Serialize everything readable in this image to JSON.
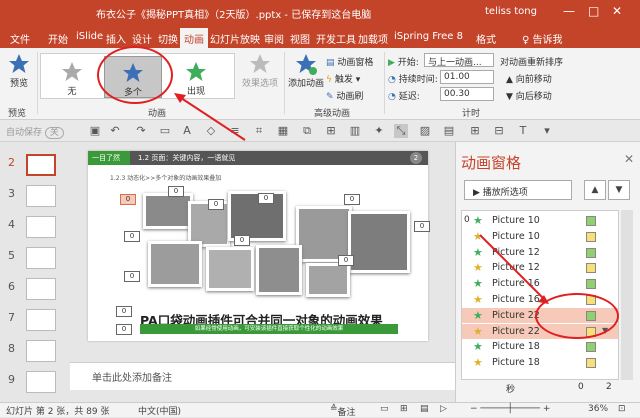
{
  "window": {
    "title": "布衣公子《揭秘PPT真相》（2天版）.pptx - 已保存到这台电脑",
    "user": "teliss tong",
    "controls": [
      "—",
      "□",
      "✕"
    ]
  },
  "tabs": [
    "文件",
    "开始",
    "iSlide",
    "插入",
    "设计",
    "切换",
    "动画",
    "幻灯片放映",
    "审阅",
    "视图",
    "开发工具",
    "加载项",
    "iSpring Free 8",
    "格式"
  ],
  "active_tab": "动画",
  "help": "告诉我",
  "ribbon": {
    "preview": {
      "label": "预览",
      "group": "预览"
    },
    "gallery": [
      {
        "label": "无"
      },
      {
        "label": "多个"
      },
      {
        "label": "出现"
      }
    ],
    "effect_options": "效果选项",
    "animation_group": "动画",
    "add_animation": "添加动画",
    "anim_pane_btn": "动画窗格",
    "trigger": "触发",
    "anim_painter": "动画刷",
    "advanced_group": "高级动画",
    "start_label": "开始:",
    "start_value": "与上一动画...",
    "duration_label": "持续时间:",
    "duration_value": "01.00",
    "delay_label": "延迟:",
    "delay_value": "00.30",
    "reorder_title": "对动画重新排序",
    "move_earlier": "向前移动",
    "move_later": "向后移动",
    "timing_group": "计时"
  },
  "qat": {
    "autosave": "自动保存",
    "autosave_state": "关"
  },
  "thumbnails": [
    "2",
    "3",
    "4",
    "5",
    "6",
    "7",
    "8",
    "9"
  ],
  "current_slide": "2",
  "slide": {
    "badge": "一目了然",
    "header": "1.2 页面：关键内容，一语就见",
    "page_no": "2",
    "subtitle": "1.2.3 动态化>>多个对象的动画效果叠加",
    "title": "PA口袋动画插件可合并同一对象的动画效果",
    "bar": "如果经常使用动画，可安装该插件直接获取个性化的动画效果",
    "anim_tags": [
      "0",
      "0",
      "0",
      "0",
      "0",
      "0",
      "0",
      "0",
      "0",
      "0",
      "0",
      "0"
    ]
  },
  "notes_placeholder": "单击此处添加备注",
  "anim_pane": {
    "title": "动画窗格",
    "play_btn": "播放所选项",
    "items": [
      {
        "idx": "0",
        "name": "Picture 10",
        "color": "#90d070",
        "highlight": false
      },
      {
        "idx": "",
        "name": "Picture 10",
        "color": "#f7e07a",
        "highlight": false
      },
      {
        "idx": "",
        "name": "Picture 12",
        "color": "#90d070",
        "highlight": false
      },
      {
        "idx": "",
        "name": "Picture 12",
        "color": "#f7e07a",
        "highlight": false
      },
      {
        "idx": "",
        "name": "Picture 16",
        "color": "#90d070",
        "highlight": false
      },
      {
        "idx": "",
        "name": "Picture 16",
        "color": "#f7e07a",
        "highlight": false
      },
      {
        "idx": "",
        "name": "Picture 22",
        "color": "#90d070",
        "highlight": true
      },
      {
        "idx": "",
        "name": "Picture 22",
        "color": "#f7e07a",
        "highlight": true
      },
      {
        "idx": "",
        "name": "Picture 18",
        "color": "#90d070",
        "highlight": false
      },
      {
        "idx": "",
        "name": "Picture 18",
        "color": "#f7e07a",
        "highlight": false
      }
    ],
    "footer_label": "秒",
    "footer_value": "0",
    "footer_value2": "2"
  },
  "status": {
    "slide_info": "幻灯片 第 2 张，共 89 张",
    "language": "中文(中国)",
    "notes": "备注",
    "zoom": "36%"
  },
  "colors": {
    "accent": "#c4442a",
    "green": "#3a9a3a"
  }
}
